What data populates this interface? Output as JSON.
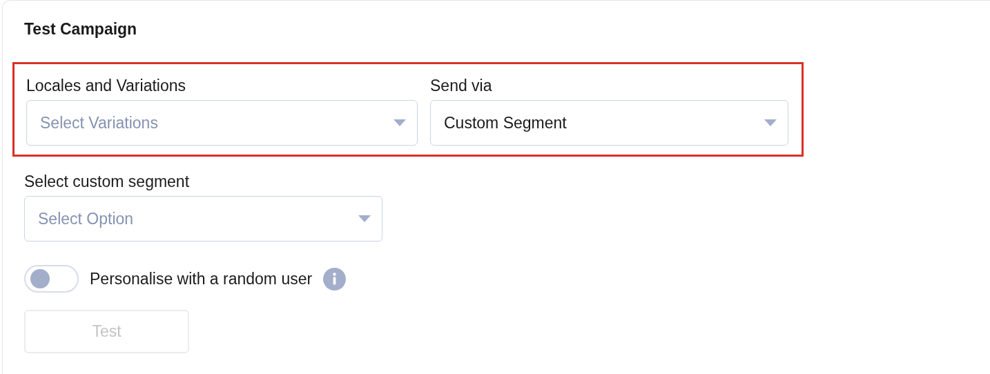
{
  "title": "Test Campaign",
  "highlighted_group": {
    "highlighted": true,
    "fields": [
      {
        "label": "Locales and Variations",
        "placeholder": "Select Variations"
      },
      {
        "label": "Send via",
        "value": "Custom Segment"
      }
    ]
  },
  "custom_segment": {
    "label": "Select custom segment",
    "placeholder": "Select Option"
  },
  "toggle": {
    "label": "Personalise with a random user",
    "on": false
  },
  "test_button": {
    "label": "Test",
    "disabled": true
  }
}
